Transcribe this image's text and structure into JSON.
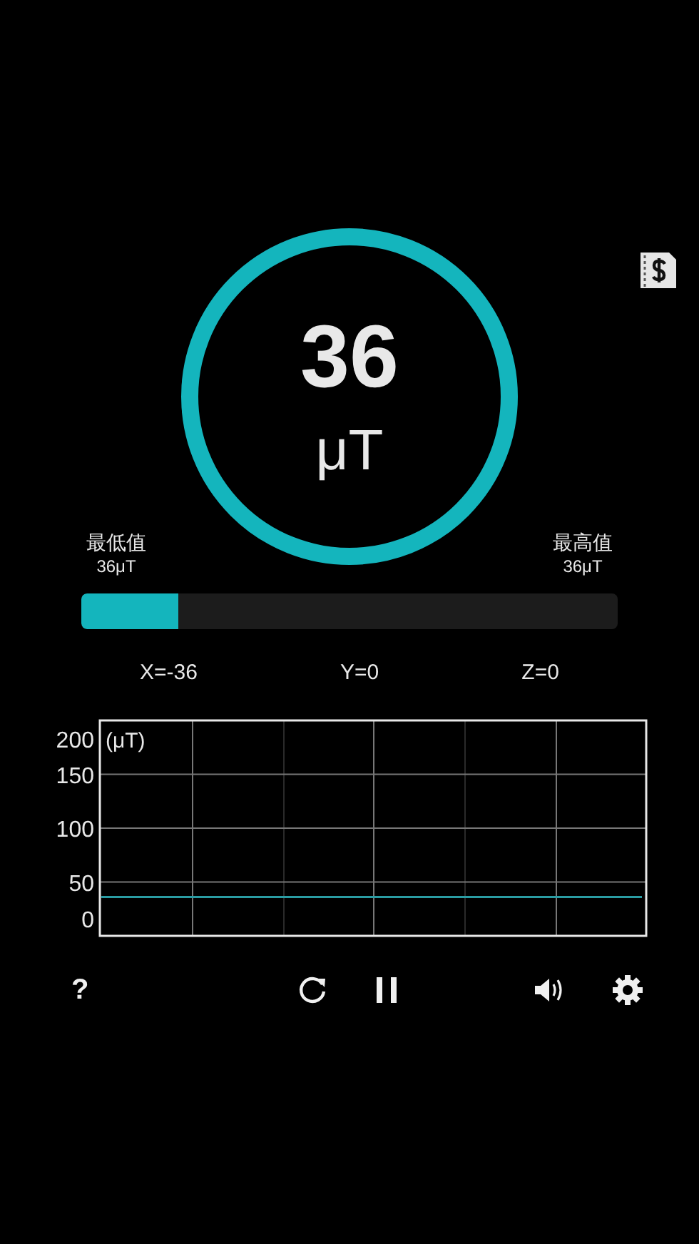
{
  "reading": {
    "value": "36",
    "unit": "μT"
  },
  "min": {
    "label": "最低值",
    "value": "36μT"
  },
  "max": {
    "label": "最高值",
    "value": "36μT"
  },
  "strength_bar": {
    "level": 0.18
  },
  "axes": [
    {
      "text": "X=-36"
    },
    {
      "text": "Y=0"
    },
    {
      "text": "Z=0"
    }
  ],
  "graph": {
    "chart_data": {
      "type": "line",
      "grid": true,
      "ylabel": "(μT)",
      "ylim": [
        0,
        200
      ],
      "yticks": [
        0,
        50,
        100,
        150,
        200
      ],
      "series": [
        {
          "color": "#2a9ca3",
          "values": [
            36,
            36,
            36,
            36,
            36,
            36,
            36,
            36,
            36,
            36
          ]
        }
      ]
    }
  },
  "help": {
    "text": "?"
  }
}
